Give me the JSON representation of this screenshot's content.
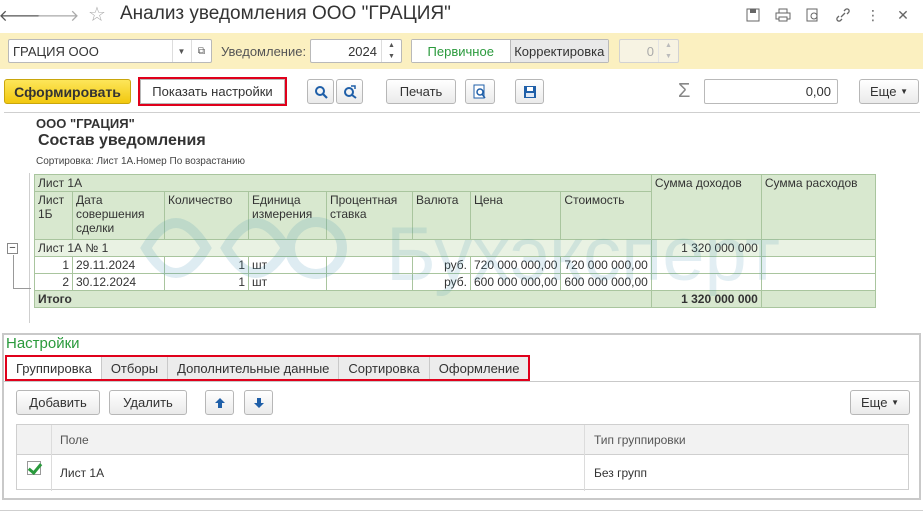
{
  "window": {
    "title": "Анализ уведомления ООО \"ГРАЦИЯ\"",
    "back_icon": "arrow-left-icon",
    "forward_icon": "arrow-right-icon",
    "favorite_icon": "star-icon"
  },
  "params": {
    "organization": "ГРАЦИЯ ООО",
    "notice_label": "Уведомление:",
    "year": "2024",
    "kind_primary": "Первичное",
    "kind_correction": "Корректировка",
    "correction_number": "0"
  },
  "toolbar": {
    "generate": "Сформировать",
    "show_settings": "Показать настройки",
    "print": "Печать",
    "sum_value": "0,00",
    "more": "Еще"
  },
  "report": {
    "org": "ООО \"ГРАЦИЯ\"",
    "title": "Состав уведомления",
    "sorting": "Сортировка: Лист 1А.Номер По возрастанию",
    "header_sheet": "Лист 1А",
    "col_sheet1b": "Лист 1Б",
    "col_date": "Дата совершения сделки",
    "col_qty": "Количество",
    "col_unit": "Единица измерения",
    "col_rate": "Процентная ставка",
    "col_currency": "Валюта",
    "col_price": "Цена",
    "col_cost": "Стоимость",
    "col_income": "Сумма доходов",
    "col_expense": "Сумма расходов",
    "group_label": "Лист 1А № 1",
    "group_income": "1 320 000 000",
    "rows": [
      {
        "n": "1",
        "date": "29.11.2024",
        "qty": "1",
        "unit": "шт",
        "currency": "руб.",
        "price": "720 000 000,00",
        "cost": "720 000 000,00"
      },
      {
        "n": "2",
        "date": "30.12.2024",
        "qty": "1",
        "unit": "шт",
        "currency": "руб.",
        "price": "600 000 000,00",
        "cost": "600 000 000,00"
      }
    ],
    "total_label": "Итого",
    "total_income": "1 320 000 000",
    "watermark": "Бухэксперт"
  },
  "settings": {
    "title": "Настройки",
    "tabs": [
      "Группировка",
      "Отборы",
      "Дополнительные данные",
      "Сортировка",
      "Оформление"
    ],
    "add": "Добавить",
    "delete": "Удалить",
    "more": "Еще",
    "col_field": "Поле",
    "col_group_type": "Тип группировки",
    "row_field": "Лист 1А",
    "row_group_type": "Без групп"
  }
}
